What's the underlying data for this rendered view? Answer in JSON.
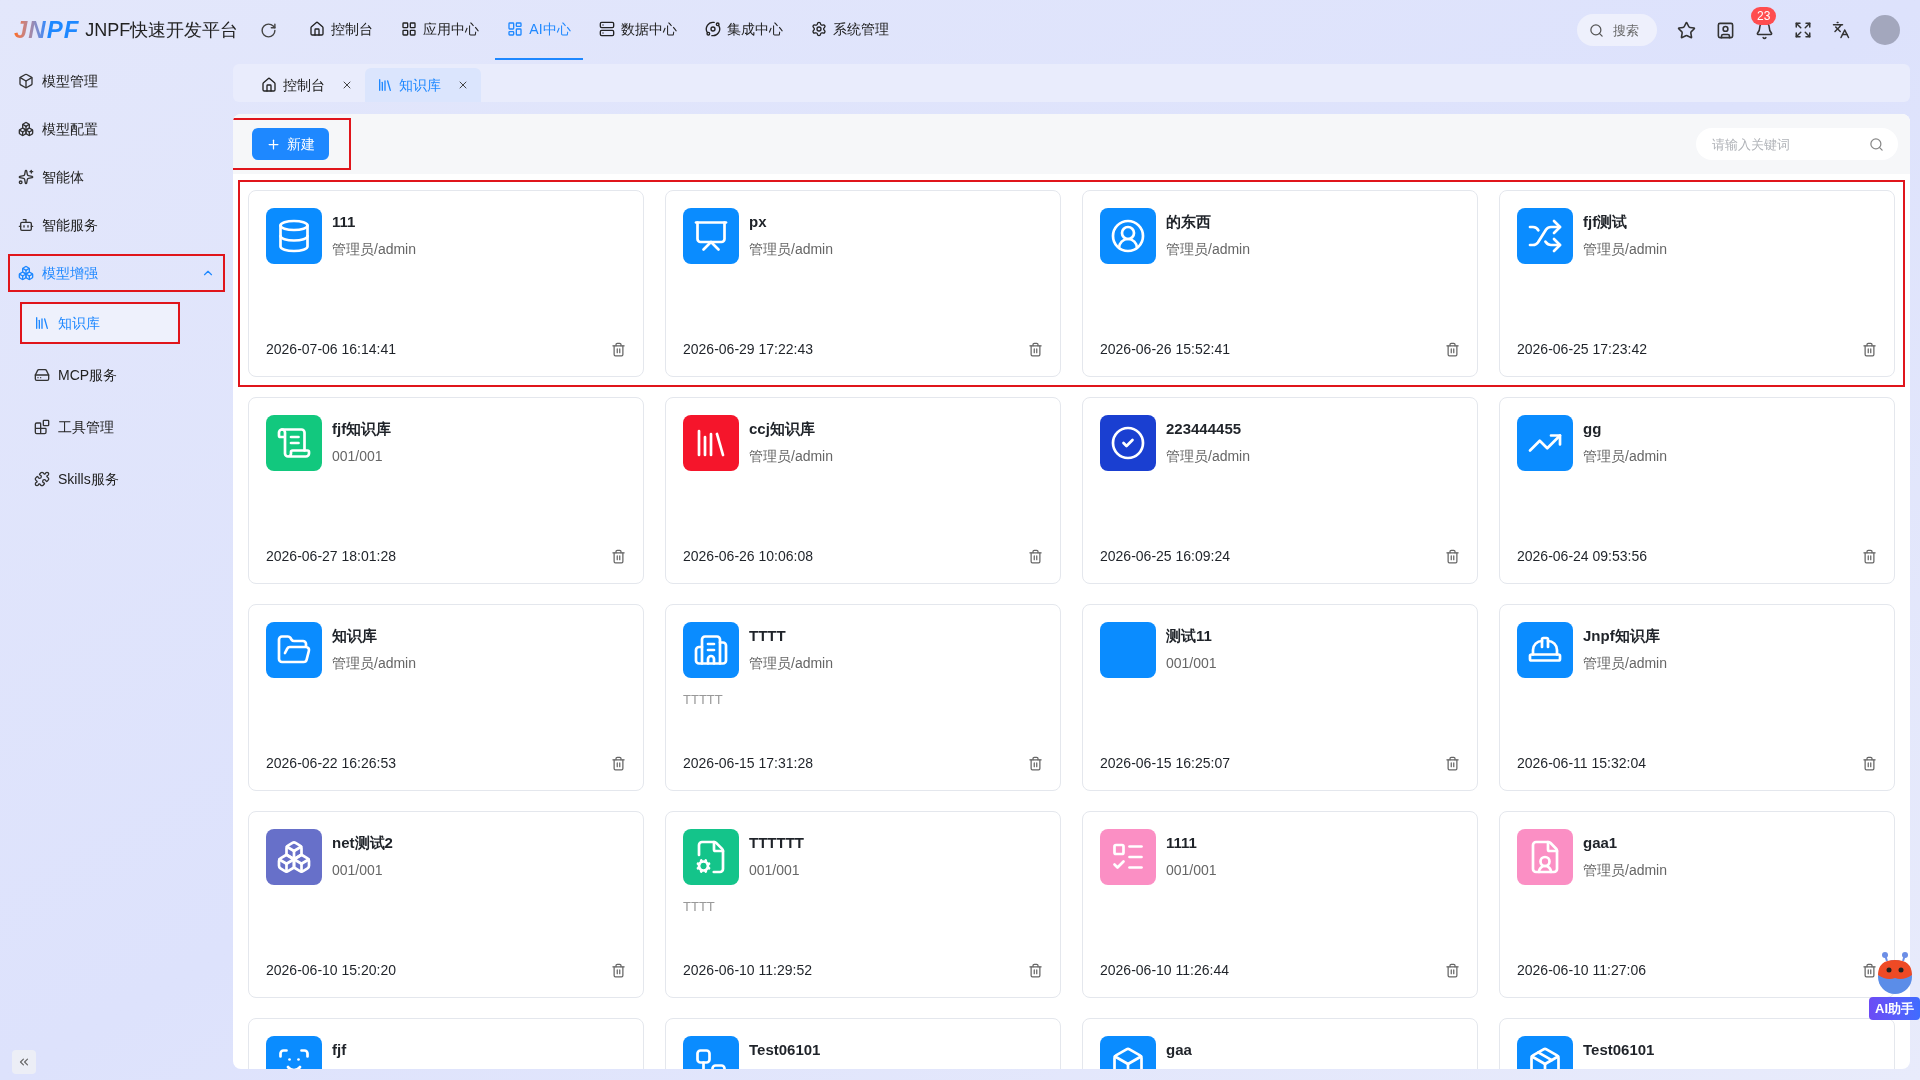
{
  "header": {
    "logo_mark": "JNPF",
    "title": "JNPF快速开发平台",
    "nav": [
      {
        "label": "控制台",
        "selected": false
      },
      {
        "label": "应用中心",
        "selected": false
      },
      {
        "label": "AI中心",
        "selected": true
      },
      {
        "label": "数据中心",
        "selected": false
      },
      {
        "label": "集成中心",
        "selected": false
      },
      {
        "label": "系统管理",
        "selected": false
      }
    ],
    "search": {
      "placeholder": "搜索"
    },
    "notification_count": "23"
  },
  "sidebar": {
    "items": [
      {
        "label": "模型管理",
        "selected": false
      },
      {
        "label": "模型配置",
        "selected": false
      },
      {
        "label": "智能体",
        "selected": false
      },
      {
        "label": "智能服务",
        "selected": false
      },
      {
        "label": "模型增强",
        "selected": false,
        "expanded": true,
        "highlighted": true,
        "children": [
          {
            "label": "知识库",
            "selected": true,
            "highlighted": true
          },
          {
            "label": "MCP服务",
            "selected": false,
            "highlighted": false
          },
          {
            "label": "工具管理",
            "selected": false,
            "highlighted": false
          },
          {
            "label": "Skills服务",
            "selected": false,
            "highlighted": false
          }
        ]
      }
    ]
  },
  "tabs": [
    {
      "label": "控制台",
      "selected": false
    },
    {
      "label": "知识库",
      "selected": true
    }
  ],
  "toolbar": {
    "new_button": {
      "label": "新建",
      "highlighted": true
    },
    "search": {
      "placeholder": "请输入关键词"
    }
  },
  "card_rows": [
    {
      "highlighted": true,
      "cards": [
        {
          "name": "111",
          "owner": "管理员/admin",
          "date": "2026-07-06 16:14:41",
          "color": "#0a8cff"
        },
        {
          "name": "px",
          "owner": "管理员/admin",
          "date": "2026-06-29 17:22:43",
          "color": "#0a8cff"
        },
        {
          "name": "的东西",
          "owner": "管理员/admin",
          "date": "2026-06-26 15:52:41",
          "color": "#0a8cff"
        },
        {
          "name": "fjf测试",
          "owner": "管理员/admin",
          "date": "2026-06-25 17:23:42",
          "color": "#0a8cff"
        }
      ]
    },
    {
      "highlighted": false,
      "cards": [
        {
          "name": "fjf知识库",
          "owner": "001/001",
          "date": "2026-06-27 18:01:28",
          "color": "#12c87e"
        },
        {
          "name": "ccj知识库",
          "owner": "管理员/admin",
          "date": "2026-06-26 10:06:08",
          "color": "#f5152b"
        },
        {
          "name": "223444455",
          "owner": "管理员/admin",
          "date": "2026-06-25 16:09:24",
          "color": "#1a3fd1"
        },
        {
          "name": "gg",
          "owner": "管理员/admin",
          "date": "2026-06-24 09:53:56",
          "color": "#0a8cff"
        }
      ]
    },
    {
      "highlighted": false,
      "cards": [
        {
          "name": "知识库",
          "owner": "管理员/admin",
          "date": "2026-06-22 16:26:53",
          "color": "#0a8cff"
        },
        {
          "name": "TTTT",
          "owner": "管理员/admin",
          "description": "TTTTT",
          "date": "2026-06-15 17:31:28",
          "color": "#0a8cff"
        },
        {
          "name": "测试11",
          "owner": "001/001",
          "date": "2026-06-15 16:25:07",
          "color": "#0a8cff"
        },
        {
          "name": "Jnpf知识库",
          "owner": "管理员/admin",
          "date": "2026-06-11 15:32:04",
          "color": "#0a8cff"
        }
      ]
    },
    {
      "highlighted": false,
      "cards": [
        {
          "name": "net测试2",
          "owner": "001/001",
          "date": "2026-06-10 15:20:20",
          "color": "#6770c9"
        },
        {
          "name": "TTTTTT",
          "owner": "001/001",
          "description": "TTTT",
          "date": "2026-06-10 11:29:52",
          "color": "#14c48a"
        },
        {
          "name": "1111",
          "owner": "001/001",
          "date": "2026-06-10 11:26:44",
          "color": "#fb8fc4"
        },
        {
          "name": "gaa1",
          "owner": "管理员/admin",
          "date": "2026-06-10 11:27:06",
          "color": "#fb8fc4"
        }
      ]
    },
    {
      "highlighted": false,
      "cards": [
        {
          "name": "fjf",
          "color": "#0a8cff"
        },
        {
          "name": "Test06101",
          "color": "#0a8cff"
        },
        {
          "name": "gaa",
          "color": "#0a8cff"
        },
        {
          "name": "Test06101",
          "color": "#0a8cff"
        }
      ]
    }
  ],
  "assistant": {
    "label": "AI助手"
  }
}
